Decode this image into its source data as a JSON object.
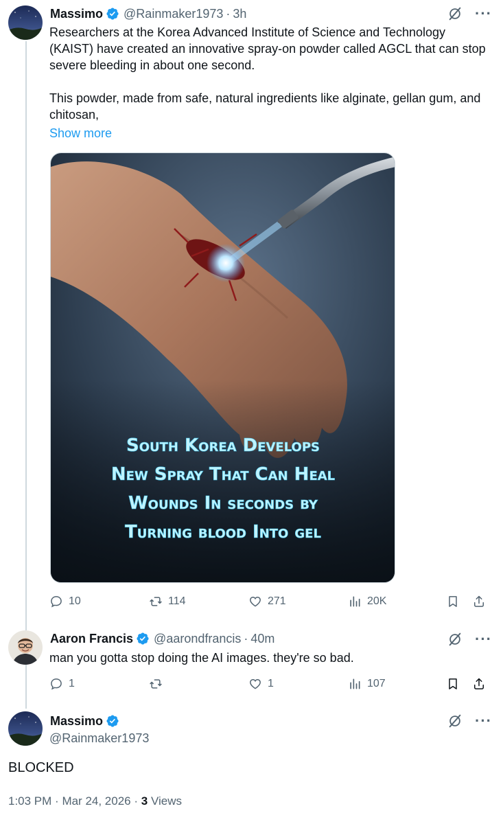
{
  "tweet1": {
    "name": "Massimo",
    "handle": "@Rainmaker1973",
    "time": "3h",
    "text": "Researchers at the Korea Advanced Institute of Science and Technology (KAIST) have created an innovative spray-on powder called AGCL that can stop severe bleeding in about one second.\n\nThis powder, made from safe, natural ingredients like alginate, gellan gum, and chitosan,",
    "show_more": "Show more",
    "image_caption": [
      "South Korea Develops",
      "New Spray That Can Heal",
      "Wounds In seconds by",
      "Turning blood Into gel"
    ],
    "replies": "10",
    "reposts": "114",
    "likes": "271",
    "views": "20K"
  },
  "tweet2": {
    "name": "Aaron Francis",
    "handle": "@aarondfrancis",
    "time": "40m",
    "text": "man you gotta stop doing the AI images. they're so bad.",
    "replies": "1",
    "reposts": "",
    "likes": "1",
    "views": "107"
  },
  "tweet3": {
    "name": "Massimo",
    "handle": "@Rainmaker1973",
    "text": "BLOCKED",
    "time": "1:03 PM",
    "date": "Mar 24, 2026",
    "views_count": "3",
    "views_label": "Views"
  },
  "colors": {
    "text": "#0f1419",
    "secondary": "#536471",
    "link": "#1d9bf0",
    "verified": "#1d9bf0",
    "thread_line": "#cfd9de",
    "caption_glow": "#7fe3ff"
  },
  "icons": [
    "verified-badge-icon",
    "grok-icon",
    "more-icon",
    "reply-icon",
    "repost-icon",
    "like-icon",
    "views-icon",
    "bookmark-icon",
    "share-icon"
  ]
}
